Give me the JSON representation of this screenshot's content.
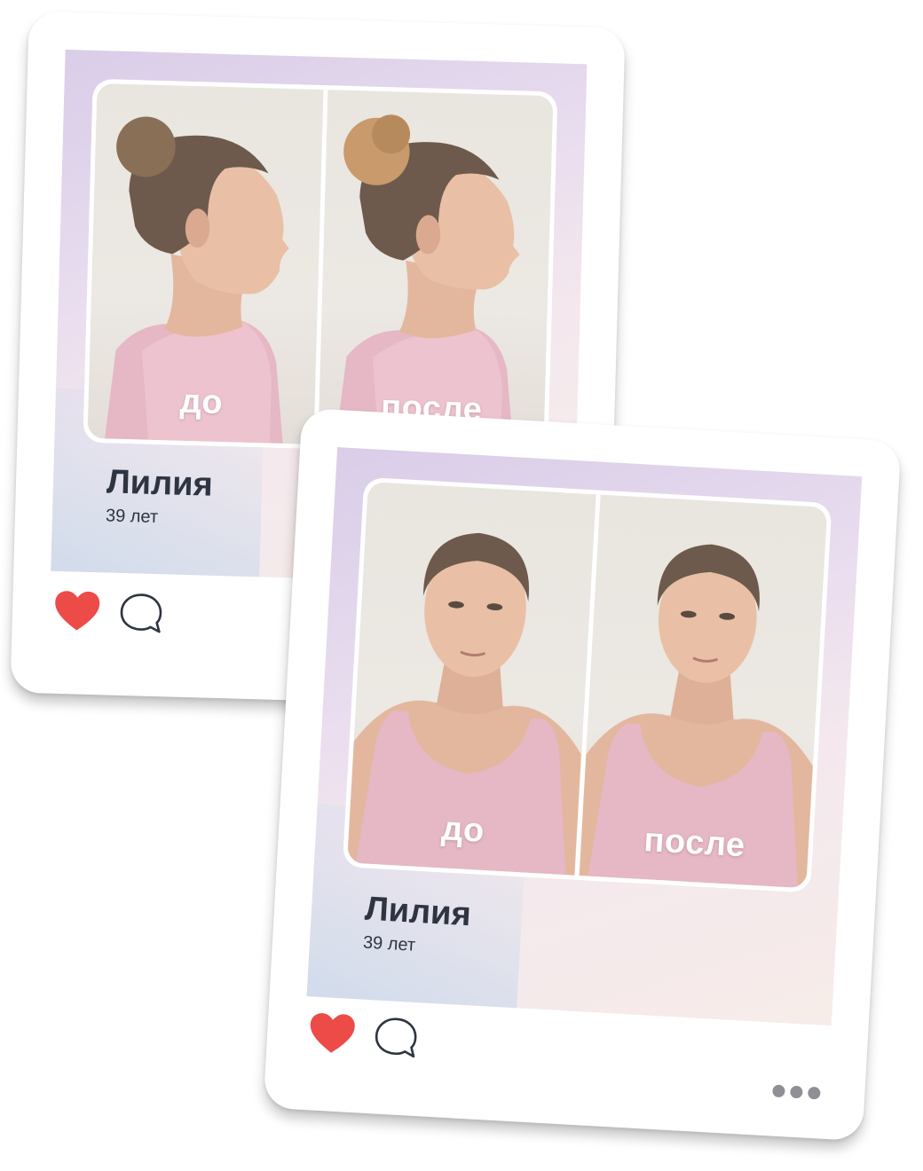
{
  "posts": [
    {
      "name": "Лилия",
      "age": "39 лет",
      "before_label": "до",
      "after_label": "после",
      "view": "profile",
      "liked": true
    },
    {
      "name": "Лилия",
      "age": "39 лет",
      "before_label": "до",
      "after_label": "после",
      "view": "front",
      "liked": true
    }
  ],
  "colors": {
    "heart": "#ec4b48",
    "text": "#2e3442",
    "panel_gradient_start": "#d9cde8",
    "panel_gradient_end": "#f6ece8",
    "top_color": "#e9b6c8"
  },
  "icons": [
    "heart-icon",
    "comment-icon",
    "more-icon"
  ]
}
